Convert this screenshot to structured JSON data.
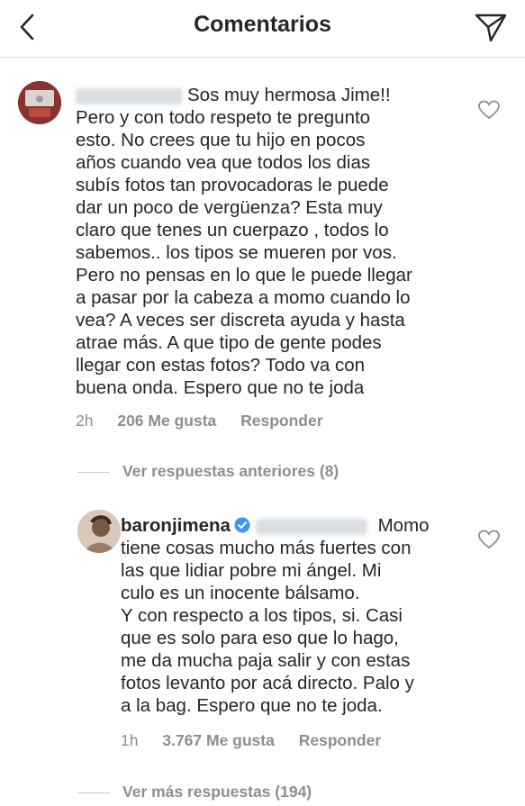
{
  "header": {
    "title": "Comentarios",
    "back_icon": "chevron-left-icon",
    "send_icon": "paper-plane-icon"
  },
  "comment1": {
    "lines": [
      "Sos muy hermosa Jime!!",
      "Pero y con todo respeto te pregunto",
      "esto.  No crees que tu hijo en pocos",
      "años cuando vea que todos los dias",
      "subís fotos tan provocadoras le puede",
      "dar un poco de vergüenza?  Esta muy",
      "claro que tenes un cuerpazo , todos lo",
      "sabemos.. los tipos se mueren por vos.",
      "Pero no pensas en lo que le puede llegar",
      "a pasar por la cabeza a momo cuando lo",
      "vea? A veces ser discreta ayuda y hasta",
      "atrae más. A que tipo de gente podes",
      "llegar con estas fotos? Todo va con",
      "buena onda. Espero que no te joda"
    ],
    "time": "2h",
    "likes": "206 Me gusta",
    "reply": "Responder"
  },
  "previous_replies": "Ver respuestas anteriores (8)",
  "comment2": {
    "username": "baronjimena",
    "first_line_text": "Momo",
    "lines": [
      "tiene cosas mucho más fuertes con",
      "las que lidiar pobre mi ángel. Mi",
      "culo es un inocente bálsamo.",
      "Y con respecto a los tipos, si. Casi",
      "que es solo para eso que lo hago,",
      "me da mucha paja salir y con estas",
      "fotos levanto por acá directo. Palo y",
      "a la bag. Espero que no te joda."
    ],
    "time": "1h",
    "likes": "3.767 Me gusta",
    "reply": "Responder"
  },
  "more_replies": "Ver más respuestas (194)",
  "colors": {
    "text": "#262626",
    "muted": "#8e8e8e",
    "verified": "#3897f0",
    "divider": "#dbdbdb"
  }
}
